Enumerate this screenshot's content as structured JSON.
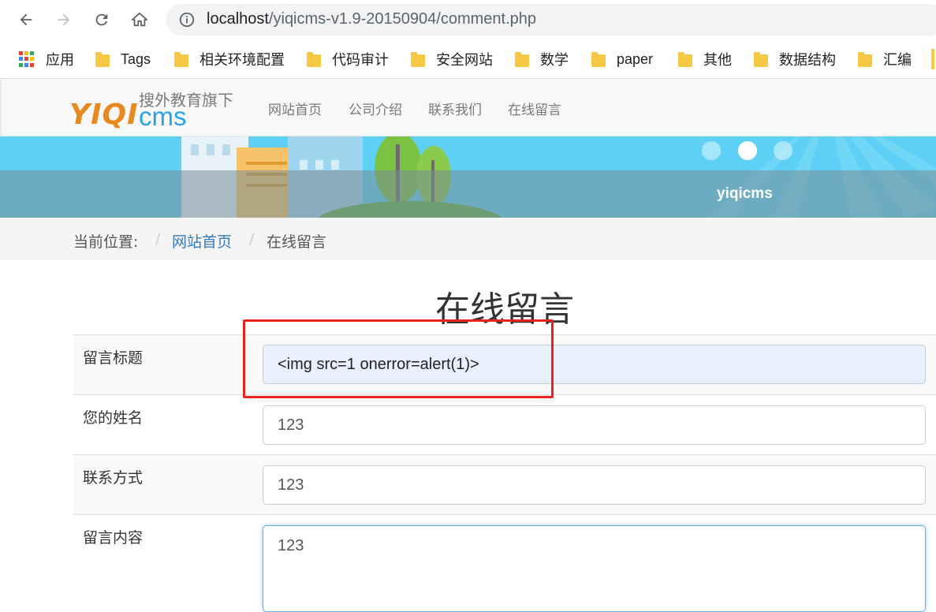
{
  "browser": {
    "url_host": "localhost",
    "url_path": "/yiqicms-v1.9-20150904/comment.php"
  },
  "bookmarks": [
    {
      "label": "应用",
      "icon": "apps-grid-icon"
    },
    {
      "label": "Tags",
      "icon": "folder-icon"
    },
    {
      "label": "相关环境配置",
      "icon": "folder-icon"
    },
    {
      "label": "代码审计",
      "icon": "folder-icon"
    },
    {
      "label": "安全网站",
      "icon": "folder-icon"
    },
    {
      "label": "数学",
      "icon": "folder-icon"
    },
    {
      "label": "paper",
      "icon": "folder-icon"
    },
    {
      "label": "其他",
      "icon": "folder-icon"
    },
    {
      "label": "数据结构",
      "icon": "folder-icon"
    },
    {
      "label": "汇编",
      "icon": "folder-icon"
    }
  ],
  "site": {
    "logo_text_yiqi": "YIQI",
    "logo_text_cms": "cms",
    "logo_subtitle": "搜外教育旗下",
    "nav": [
      "网站首页",
      "公司介绍",
      "联系我们",
      "在线留言"
    ],
    "banner_caption": "yiqicms"
  },
  "breadcrumb": {
    "prefix": "当前位置:",
    "sep": "/",
    "home": "网站首页",
    "current": "在线留言"
  },
  "form": {
    "title": "在线留言",
    "fields": [
      {
        "label": "留言标题",
        "value": "<img src=1 onerror=alert(1)>"
      },
      {
        "label": "您的姓名",
        "value": "123"
      },
      {
        "label": "联系方式",
        "value": "123"
      },
      {
        "label": "留言内容",
        "value": "123"
      }
    ]
  },
  "colors": {
    "highlight": "#e8231c",
    "link": "#337ab7",
    "banner_sky": "#5fd0f5",
    "logo_orange": "#e8891d",
    "logo_blue": "#2ba3e0"
  }
}
